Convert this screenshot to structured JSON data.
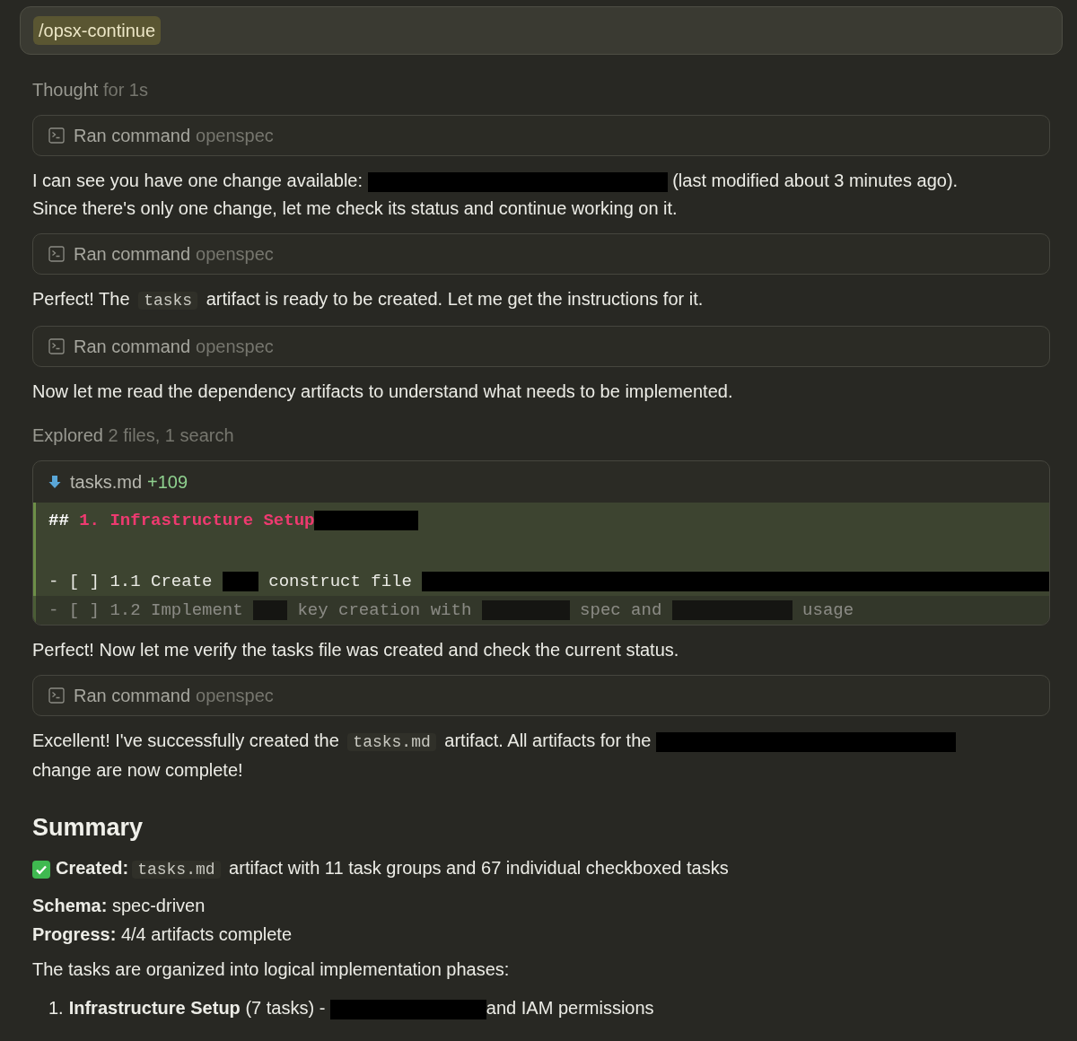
{
  "prompt": {
    "command": "/opsx-continue"
  },
  "blocks": [
    {
      "kind": "status",
      "label": "Thought",
      "detail": "for 1s"
    },
    {
      "kind": "tool",
      "action": "Ran command",
      "target": "openspec"
    },
    {
      "kind": "paragraph",
      "segments": [
        {
          "kind": "text",
          "text": "I can see you have one change available: "
        },
        {
          "kind": "redacted"
        },
        {
          "kind": "text",
          "text": " (last modified about 3 minutes ago)."
        },
        {
          "kind": "break"
        },
        {
          "kind": "text",
          "text": "Since there's only one change, let me check its status and continue working on it."
        }
      ]
    },
    {
      "kind": "tool",
      "action": "Ran command",
      "target": "openspec"
    },
    {
      "kind": "paragraph",
      "segments": [
        {
          "kind": "text",
          "text": "Perfect! The "
        },
        {
          "kind": "code",
          "text": "tasks"
        },
        {
          "kind": "text",
          "text": " artifact is ready to be created. Let me get the instructions for it."
        }
      ]
    },
    {
      "kind": "tool",
      "action": "Ran command",
      "target": "openspec"
    },
    {
      "kind": "paragraph",
      "segments": [
        {
          "kind": "text",
          "text": "Now let me read the dependency artifacts to understand what needs to be implemented."
        }
      ]
    },
    {
      "kind": "status",
      "label": "Explored",
      "detail": "2 files, 1 search"
    },
    {
      "kind": "diff",
      "file": "tasks.md",
      "added": "+109",
      "lines": [
        {
          "added": true,
          "faded": false,
          "segments": [
            {
              "kind": "hash",
              "text": "##"
            },
            {
              "kind": "heading",
              "text": " 1. Infrastructure Setup"
            },
            {
              "kind": "redacted"
            }
          ]
        },
        {
          "added": true,
          "faded": false
        },
        {
          "added": true,
          "faded": false,
          "segments": [
            {
              "kind": "plain",
              "text": "- [ ] 1.1 Create "
            },
            {
              "kind": "redacted"
            },
            {
              "kind": "plain",
              "text": " construct file "
            },
            {
              "kind": "redacted"
            }
          ]
        },
        {
          "added": true,
          "faded": true,
          "segments": [
            {
              "kind": "plain",
              "text": "- [ ] 1.2 Implement "
            },
            {
              "kind": "redacted"
            },
            {
              "kind": "plain",
              "text": " key creation with "
            },
            {
              "kind": "redacted"
            },
            {
              "kind": "plain",
              "text": " spec and "
            },
            {
              "kind": "redacted"
            },
            {
              "kind": "plain",
              "text": " usage"
            }
          ]
        }
      ]
    },
    {
      "kind": "paragraph",
      "segments": [
        {
          "kind": "text",
          "text": "Perfect! Now let me verify the tasks file was created and check the current status."
        }
      ]
    },
    {
      "kind": "tool",
      "action": "Ran command",
      "target": "openspec"
    },
    {
      "kind": "paragraph",
      "segments": [
        {
          "kind": "text",
          "text": "Excellent! I've successfully created the "
        },
        {
          "kind": "code",
          "text": "tasks.md"
        },
        {
          "kind": "text",
          "text": " artifact. All artifacts for the "
        },
        {
          "kind": "redacted"
        },
        {
          "kind": "break"
        },
        {
          "kind": "text",
          "text": "change are now complete!"
        }
      ]
    },
    {
      "kind": "heading",
      "text": "Summary"
    },
    {
      "kind": "paragraph",
      "done": true,
      "segments": [
        {
          "kind": "bold",
          "text": "Created:"
        },
        {
          "kind": "code",
          "text": "tasks.md"
        },
        {
          "kind": "text",
          "text": " artifact with 11 task groups and 67 individual checkboxed tasks"
        }
      ]
    },
    {
      "kind": "fields",
      "rows": [
        {
          "label": "Schema:",
          "value": "spec-driven"
        },
        {
          "label": "Progress:",
          "value": "4/4 artifacts complete"
        }
      ]
    },
    {
      "kind": "paragraph",
      "segments": [
        {
          "kind": "text",
          "text": "The tasks are organized into logical implementation phases:"
        }
      ]
    },
    {
      "kind": "list",
      "items": [
        {
          "number": "1.",
          "segments": [
            {
              "kind": "bold",
              "text": "Infrastructure Setup"
            },
            {
              "kind": "text",
              "text": " (7 tasks) - "
            },
            {
              "kind": "redacted"
            },
            {
              "kind": "text",
              "text": "and IAM permissions"
            }
          ]
        }
      ]
    }
  ]
}
